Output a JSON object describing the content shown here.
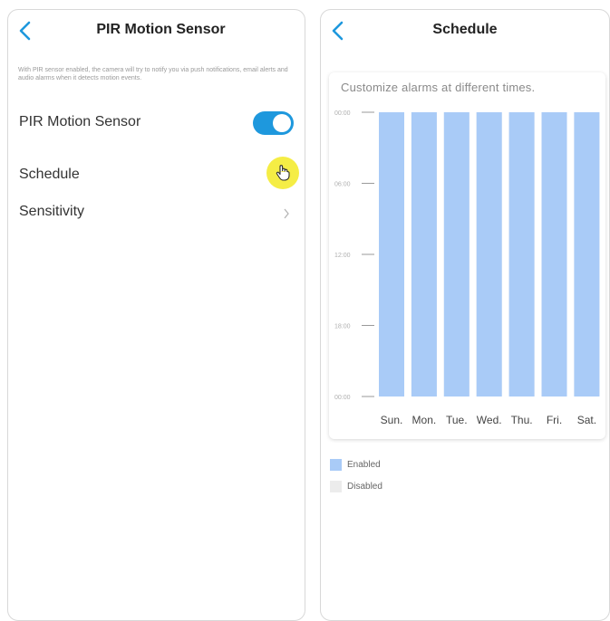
{
  "left": {
    "title": "PIR Motion Sensor",
    "description": "With PIR sensor enabled, the camera will try to notify you via push notifications, email alerts and audio alarms when it detects motion events.",
    "rows": [
      {
        "label": "PIR Motion Sensor",
        "control": "toggle",
        "on": true
      },
      {
        "label": "Schedule"
      },
      {
        "label": "Sensitivity",
        "control": "chevron"
      }
    ]
  },
  "right": {
    "title": "Schedule",
    "card_title": "Customize alarms at different times.",
    "legend": [
      {
        "label": "Enabled",
        "color": "#a9cbf7"
      },
      {
        "label": "Disabled",
        "color": "#ececec"
      }
    ]
  },
  "colors": {
    "accent": "#1e98dd",
    "enabled": "#a9cbf7",
    "disabled": "#ececec",
    "cursor_highlight": "#f5ed3c"
  },
  "chart_data": {
    "type": "bar",
    "categories": [
      "Sun.",
      "Mon.",
      "Tue.",
      "Wed.",
      "Thu.",
      "Fri.",
      "Sat."
    ],
    "y_ticks": [
      "00:00",
      "06:00",
      "12:00",
      "18:00",
      "00:00"
    ],
    "ylim": [
      0,
      24
    ],
    "series": [
      {
        "values": [
          [
            [
              0,
              24
            ]
          ],
          [
            [
              0,
              24
            ]
          ],
          [
            [
              0,
              24
            ]
          ],
          [
            [
              0,
              24
            ]
          ],
          [
            [
              0,
              24
            ]
          ],
          [
            [
              0,
              24
            ]
          ],
          [
            [
              0,
              24
            ]
          ]
        ]
      }
    ],
    "title": "Customize alarms at different times."
  }
}
